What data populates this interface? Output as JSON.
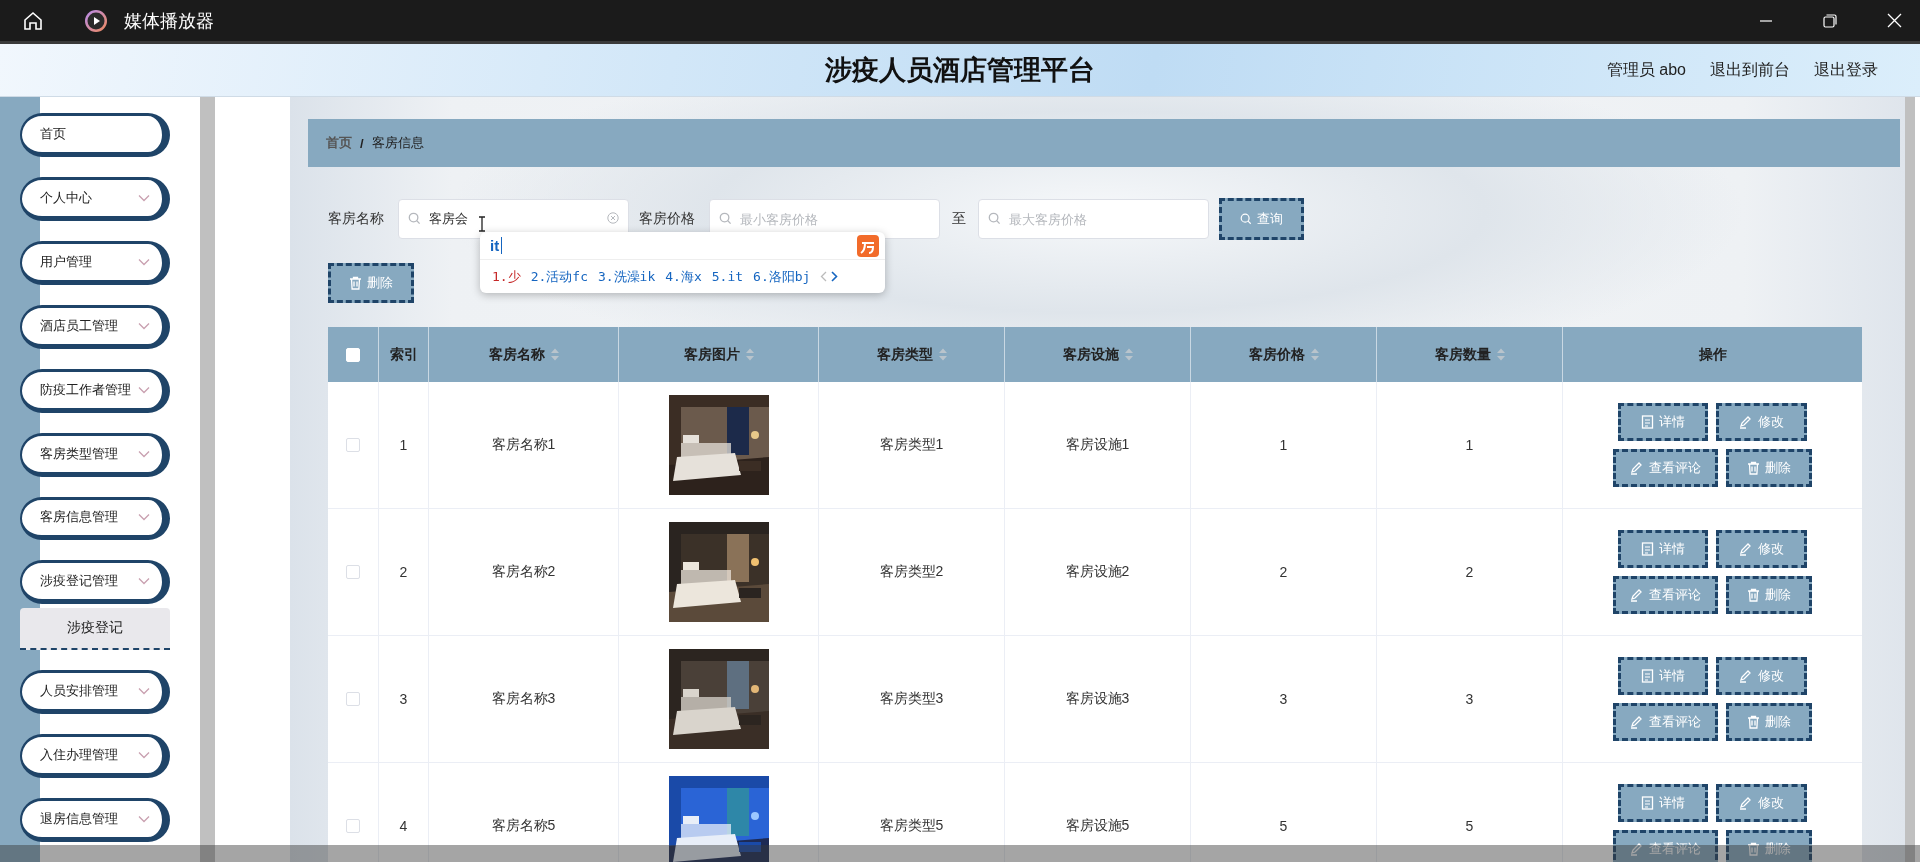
{
  "window": {
    "title": "媒体播放器"
  },
  "header": {
    "title": "涉疫人员酒店管理平台",
    "user": "管理员 abo",
    "links": [
      "退出到前台",
      "退出登录"
    ]
  },
  "sidebar": {
    "items": [
      {
        "label": "首页",
        "kind": "link"
      },
      {
        "label": "个人中心",
        "kind": "menu"
      },
      {
        "label": "用户管理",
        "kind": "menu"
      },
      {
        "label": "酒店员工管理",
        "kind": "menu"
      },
      {
        "label": "防疫工作者管理",
        "kind": "menu"
      },
      {
        "label": "客房类型管理",
        "kind": "menu"
      },
      {
        "label": "客房信息管理",
        "kind": "menu"
      },
      {
        "label": "涉疫登记管理",
        "kind": "menu",
        "children": [
          {
            "label": "涉疫登记"
          }
        ]
      },
      {
        "label": "人员安排管理",
        "kind": "menu"
      },
      {
        "label": "入住办理管理",
        "kind": "menu"
      },
      {
        "label": "退房信息管理",
        "kind": "menu"
      }
    ]
  },
  "breadcrumb": {
    "items": [
      "首页",
      "客房信息"
    ],
    "separator": "/"
  },
  "search": {
    "name_label": "客房名称",
    "name_value": "客房会",
    "price_label": "客房价格",
    "min_placeholder": "最小客房价格",
    "to": "至",
    "max_placeholder": "最大客房价格",
    "query_button": "查询"
  },
  "ime": {
    "composition": "it",
    "candidates": [
      {
        "text": "1.少",
        "selected": true
      },
      {
        "text": "2.活动fc",
        "selected": false
      },
      {
        "text": "3.洗澡ik",
        "selected": false
      },
      {
        "text": "4.海x",
        "selected": false
      },
      {
        "text": "5.it",
        "selected": false
      },
      {
        "text": "6.洛阳bj",
        "selected": false
      }
    ]
  },
  "delete_button": "删除",
  "table": {
    "select_all": {
      "checked": false
    },
    "columns": [
      {
        "label": "索引",
        "sortable": false
      },
      {
        "label": "客房名称",
        "sortable": true
      },
      {
        "label": "客房图片",
        "sortable": true
      },
      {
        "label": "客房类型",
        "sortable": true
      },
      {
        "label": "客房设施",
        "sortable": true
      },
      {
        "label": "客房价格",
        "sortable": true
      },
      {
        "label": "客房数量",
        "sortable": true
      },
      {
        "label": "操作",
        "sortable": false
      }
    ],
    "rows": [
      {
        "checked": false,
        "index": "1",
        "name": "客房名称1",
        "type": "客房类型1",
        "facility": "客房设施1",
        "price": "1",
        "quantity": "1",
        "actions": [
          {
            "kind": "detail",
            "label": "详情"
          },
          {
            "kind": "edit",
            "label": "修改"
          },
          {
            "kind": "review",
            "label": "查看评论"
          },
          {
            "kind": "delete",
            "label": "删除"
          }
        ]
      },
      {
        "checked": false,
        "index": "2",
        "name": "客房名称2",
        "type": "客房类型2",
        "facility": "客房设施2",
        "price": "2",
        "quantity": "2",
        "actions": [
          {
            "kind": "detail",
            "label": "详情"
          },
          {
            "kind": "edit",
            "label": "修改"
          },
          {
            "kind": "review",
            "label": "查看评论"
          },
          {
            "kind": "delete",
            "label": "删除"
          }
        ]
      },
      {
        "checked": false,
        "index": "3",
        "name": "客房名称3",
        "type": "客房类型3",
        "facility": "客房设施3",
        "price": "3",
        "quantity": "3",
        "actions": [
          {
            "kind": "detail",
            "label": "详情"
          },
          {
            "kind": "edit",
            "label": "修改"
          },
          {
            "kind": "review",
            "label": "查看评论"
          },
          {
            "kind": "delete",
            "label": "删除"
          }
        ]
      },
      {
        "checked": false,
        "index": "4",
        "name": "客房名称5",
        "type": "客房类型5",
        "facility": "客房设施5",
        "price": "5",
        "quantity": "5",
        "actions": [
          {
            "kind": "detail",
            "label": "详情"
          },
          {
            "kind": "edit",
            "label": "修改"
          },
          {
            "kind": "review",
            "label": "查看评论"
          },
          {
            "kind": "delete",
            "label": "删除"
          }
        ]
      }
    ]
  }
}
